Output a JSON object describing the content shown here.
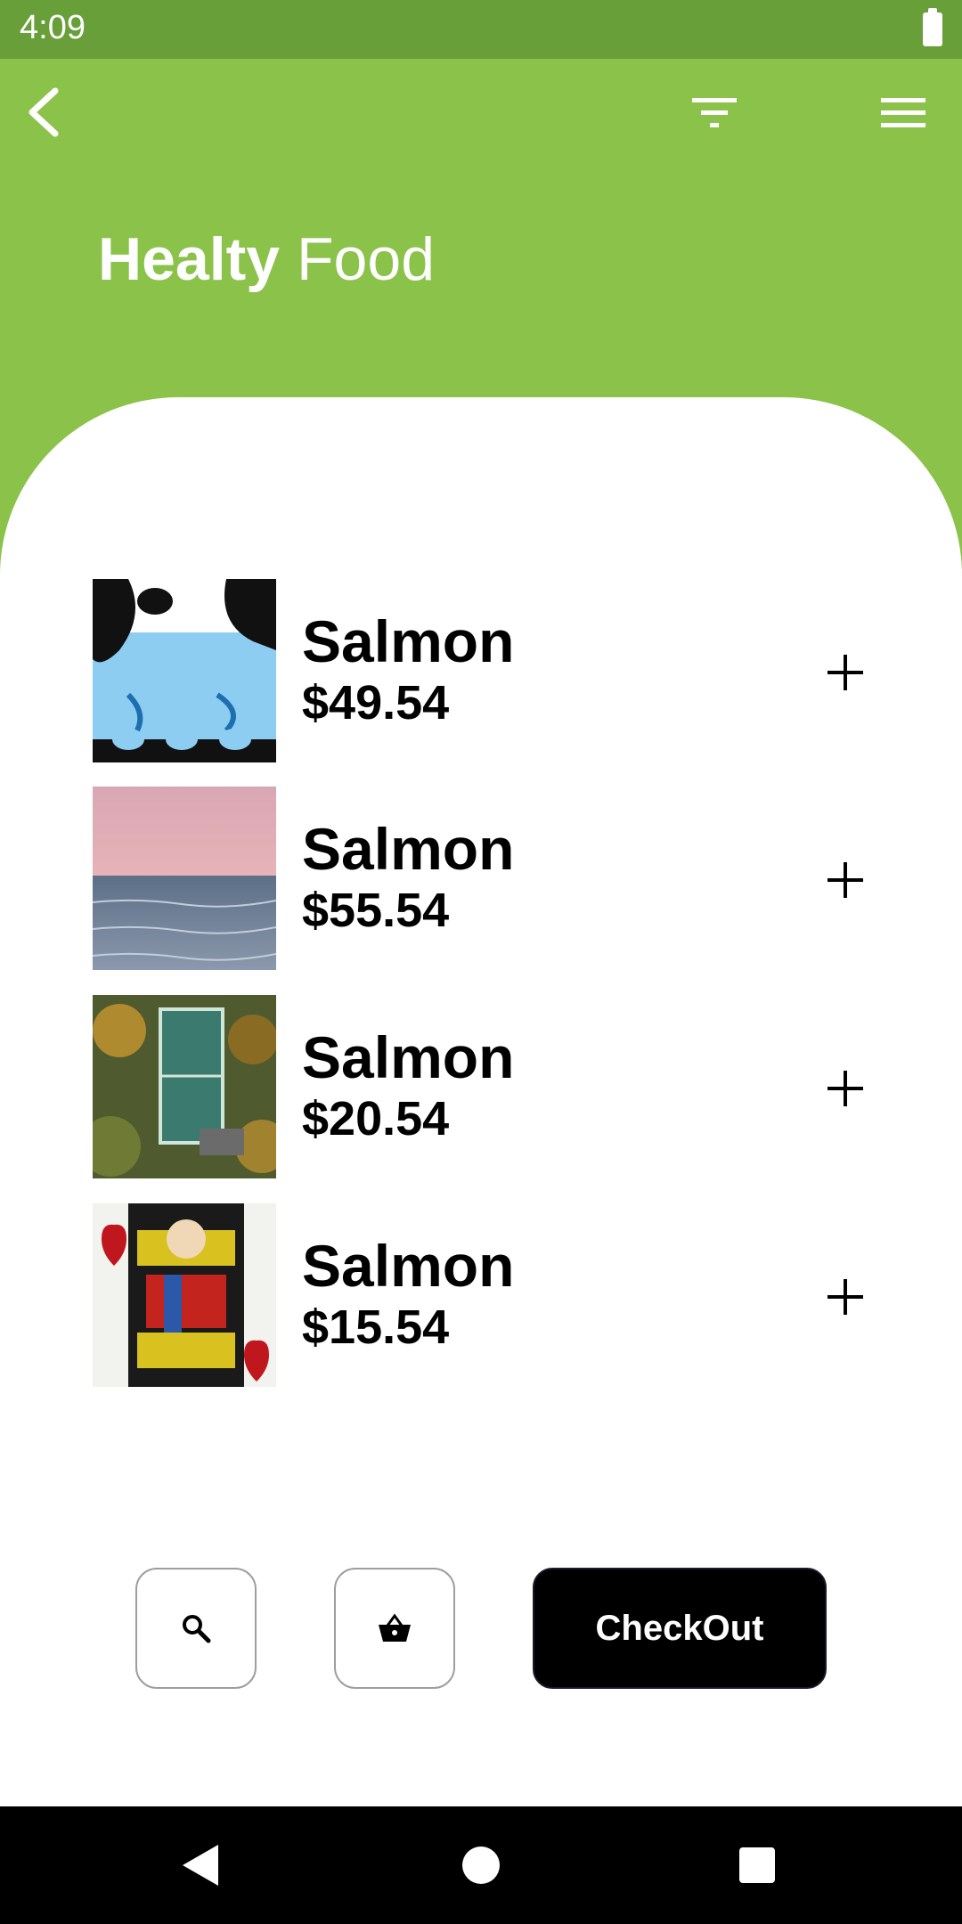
{
  "status": {
    "time": "4:09"
  },
  "header": {
    "title_bold": "Healty",
    "title_light": "Food"
  },
  "colors": {
    "primary": "#8bc34a",
    "status_bar": "#689f38",
    "checkout_bg": "#000000"
  },
  "items": [
    {
      "name": "Salmon",
      "price": "$49.54",
      "image": "blue-abstract-painting"
    },
    {
      "name": "Salmon",
      "price": "$55.54",
      "image": "sea-at-dusk"
    },
    {
      "name": "Salmon",
      "price": "$20.54",
      "image": "aerial-sports-field"
    },
    {
      "name": "Salmon",
      "price": "$15.54",
      "image": "queen-of-hearts-card"
    }
  ],
  "actions": {
    "checkout_label": "CheckOut"
  },
  "icons": {
    "back": "chevron-left-icon",
    "filter": "filter-icon",
    "menu": "hamburger-menu-icon",
    "add": "plus-icon",
    "search": "search-icon",
    "basket": "basket-icon"
  }
}
